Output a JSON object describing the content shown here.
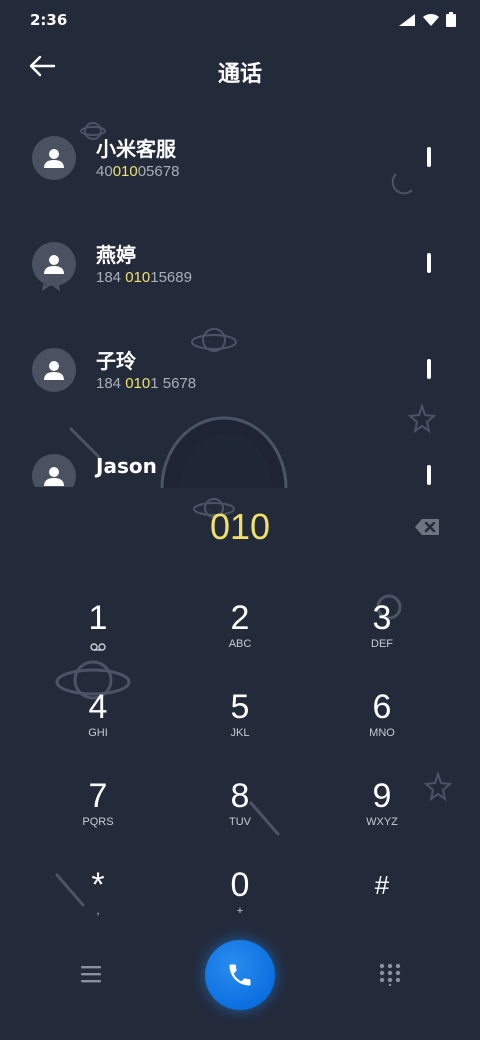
{
  "status": {
    "time": "2:36"
  },
  "header": {
    "title": "通话"
  },
  "contacts": [
    {
      "name": "小米客服",
      "number_parts": [
        "40",
        "010",
        "05678"
      ]
    },
    {
      "name": "燕婷",
      "number_parts": [
        "184 ",
        "010",
        "15689"
      ]
    },
    {
      "name": "子玲",
      "number_parts": [
        "184 ",
        "010",
        "1 5678"
      ]
    },
    {
      "name": "Jason",
      "number_parts": [
        "",
        "",
        ""
      ]
    }
  ],
  "dialer": {
    "input": "010",
    "keys": [
      {
        "digit": "1",
        "letters": ""
      },
      {
        "digit": "2",
        "letters": "ABC"
      },
      {
        "digit": "3",
        "letters": "DEF"
      },
      {
        "digit": "4",
        "letters": "GHI"
      },
      {
        "digit": "5",
        "letters": "JKL"
      },
      {
        "digit": "6",
        "letters": "MNO"
      },
      {
        "digit": "7",
        "letters": "PQRS"
      },
      {
        "digit": "8",
        "letters": "TUV"
      },
      {
        "digit": "9",
        "letters": "WXYZ"
      },
      {
        "digit": "*",
        "letters": ","
      },
      {
        "digit": "0",
        "letters": "+"
      },
      {
        "digit": "#",
        "letters": ""
      }
    ]
  },
  "colors": {
    "background": "#232b3b",
    "highlight": "#f1e06a",
    "call": "#0b6fe0"
  },
  "icons": [
    "back-arrow-icon",
    "signal-icon",
    "wifi-icon",
    "battery-icon",
    "person-icon",
    "backspace-icon",
    "voicemail-icon",
    "menu-icon",
    "phone-icon",
    "keypad-icon"
  ]
}
